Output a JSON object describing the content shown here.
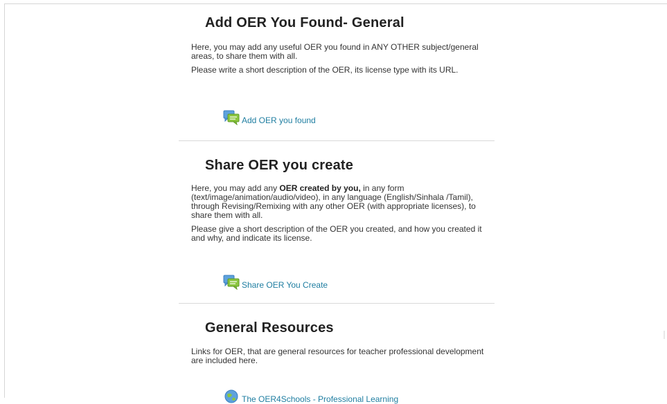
{
  "sections": [
    {
      "title": "Add OER You Found- General",
      "para1": "Here, you may add any useful OER you found in ANY OTHER subject/general areas, to share them with all.",
      "para2": "Please write a short description of the OER, its license type with its URL.",
      "activity_label": "Add OER you found",
      "activity_icon": "forum-icon"
    },
    {
      "title": "Share OER you create",
      "para1_pre": "Here, you may add any ",
      "para1_bold": "OER created by you,",
      "para1_post": " in any form (text/image/animation/audio/video), in any language (English/Sinhala /Tamil), through Revising/Remixing with any other OER (with appropriate licenses), to share them with all.",
      "para2": "Please give a short description of the OER you created, and how you created it and why, and indicate its license.",
      "activity_label": "Share OER You Create",
      "activity_icon": "forum-icon"
    },
    {
      "title": "General Resources",
      "para1": "Links for OER, that are general resources for teacher professional development are included here.",
      "activity_label": "The OER4Schools - Professional Learning",
      "activity_icon": "url-icon"
    }
  ],
  "colors": {
    "link": "#1f7ea1",
    "heading": "#222222",
    "text": "#333333",
    "divider": "#d9d9d9"
  }
}
